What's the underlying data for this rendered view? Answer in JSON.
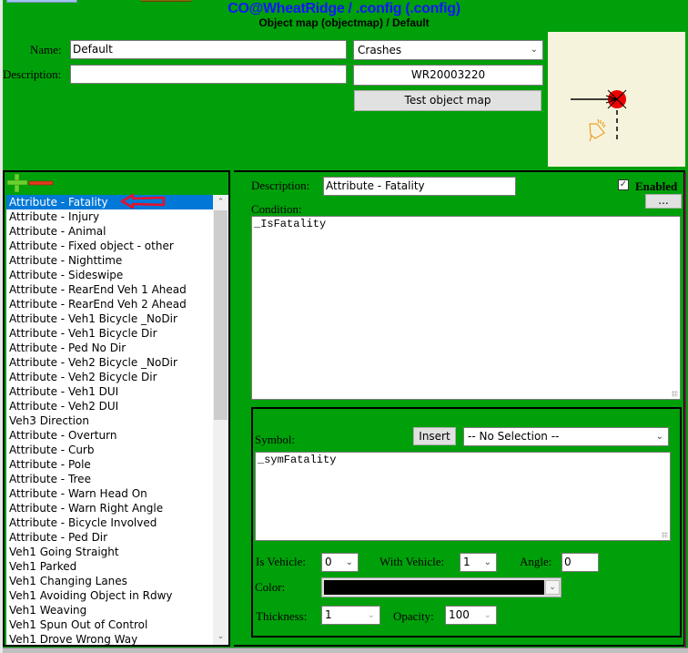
{
  "header": {
    "title": "CO@WheatRidge / .config (.config)",
    "subtitle": "Object map (objectmap) / Default"
  },
  "form": {
    "name_label": "Name:",
    "name_value": "Default",
    "description_label": "Description:",
    "description_value": "",
    "type_select": "Crashes",
    "record_value": "WR20003220",
    "test_button": "Test object map"
  },
  "colors": {
    "background": "#00a00a",
    "title": "#1515ff",
    "selection": "#0078d7",
    "symbol_red": "#ee0000",
    "preview_bg": "#f5f3dc"
  },
  "list": {
    "add_icon": "plus-icon",
    "remove_icon": "minus-icon",
    "selected_index": 0,
    "items": [
      "Attribute - Fatality",
      "Attribute - Injury",
      "Attribute - Animal",
      "Attribute - Fixed object - other",
      "Attribute - Nighttime",
      "Attribute - Sideswipe",
      "Attribute - RearEnd Veh 1 Ahead",
      "Attribute - RearEnd Veh 2 Ahead",
      "Attribute - Veh1 Bicycle _NoDir",
      "Attribute - Veh1 Bicycle Dir",
      "Attribute - Ped No Dir",
      "Attribute - Veh2 Bicycle _NoDir",
      "Attribute - Veh2 Bicycle Dir",
      "Attribute - Veh1 DUI",
      "Attribute - Veh2 DUI",
      "Veh3 Direction",
      "Attribute - Overturn",
      "Attribute - Curb",
      "Attribute - Pole",
      "Attribute - Tree",
      "Attribute - Warn Head On",
      "Attribute - Warn Right Angle",
      "Attribute - Bicycle Involved",
      "Attribute - Ped Dir",
      "Veh1 Going Straight",
      "Veh1 Parked",
      "Veh1 Changing Lanes",
      "Veh1 Avoiding Object in Rdwy",
      "Veh1 Weaving",
      "Veh1 Spun Out of Control",
      "Veh1 Drove Wrong Way"
    ]
  },
  "detail": {
    "description_label": "Description:",
    "description_value": "Attribute - Fatality",
    "enabled_label": "Enabled",
    "enabled": true,
    "more_button": "...",
    "condition_label": "Condition:",
    "condition_value": "_IsFatality",
    "symbol_label": "Symbol:",
    "insert_button": "Insert",
    "symbol_select": "-- No Selection --",
    "symbol_value": "_symFatality",
    "is_vehicle_label": "Is Vehicle:",
    "is_vehicle_value": "0",
    "with_vehicle_label": "With Vehicle:",
    "with_vehicle_value": "1",
    "angle_label": "Angle:",
    "angle_value": "0",
    "color_label": "Color:",
    "color_value": "#000000",
    "thickness_label": "Thickness:",
    "thickness_value": "1",
    "opacity_label": "Opacity:",
    "opacity_value": "100"
  }
}
